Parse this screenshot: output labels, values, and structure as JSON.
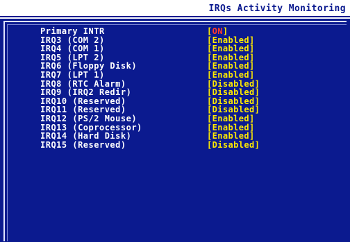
{
  "screen": {
    "title": "IRQs Activity Monitoring"
  },
  "colors": {
    "panel_bg": "#0b1a8f",
    "label_text": "#ffffff",
    "value_text": "#ffea00",
    "selected_value_text": "#ff3b2a",
    "title_text": "#0b1a8f"
  },
  "items": [
    {
      "label": "Primary INTR",
      "value_open": "[",
      "value_inner": "ON",
      "value_close": "]",
      "selected": true
    },
    {
      "label": "IRQ3  (COM 2)",
      "value": "[Enabled]"
    },
    {
      "label": "IRQ4  (COM 1)",
      "value": "[Enabled]"
    },
    {
      "label": "IRQ5  (LPT 2)",
      "value": "[Enabled]"
    },
    {
      "label": "IRQ6  (Floppy Disk)",
      "value": "[Enabled]"
    },
    {
      "label": "IRQ7  (LPT 1)",
      "value": "[Enabled]"
    },
    {
      "label": "IRQ8  (RTC Alarm)",
      "value": "[Disabled]"
    },
    {
      "label": "IRQ9  (IRQ2 Redir)",
      "value": "[Disabled]"
    },
    {
      "label": "IRQ10 (Reserved)",
      "value": "[Disabled]"
    },
    {
      "label": "IRQ11 (Reserved)",
      "value": "[Disabled]"
    },
    {
      "label": "IRQ12 (PS/2 Mouse)",
      "value": "[Enabled]"
    },
    {
      "label": "IRQ13 (Coprocessor)",
      "value": "[Enabled]"
    },
    {
      "label": "IRQ14 (Hard Disk)",
      "value": "[Enabled]"
    },
    {
      "label": "IRQ15 (Reserved)",
      "value": "[Disabled]"
    }
  ]
}
